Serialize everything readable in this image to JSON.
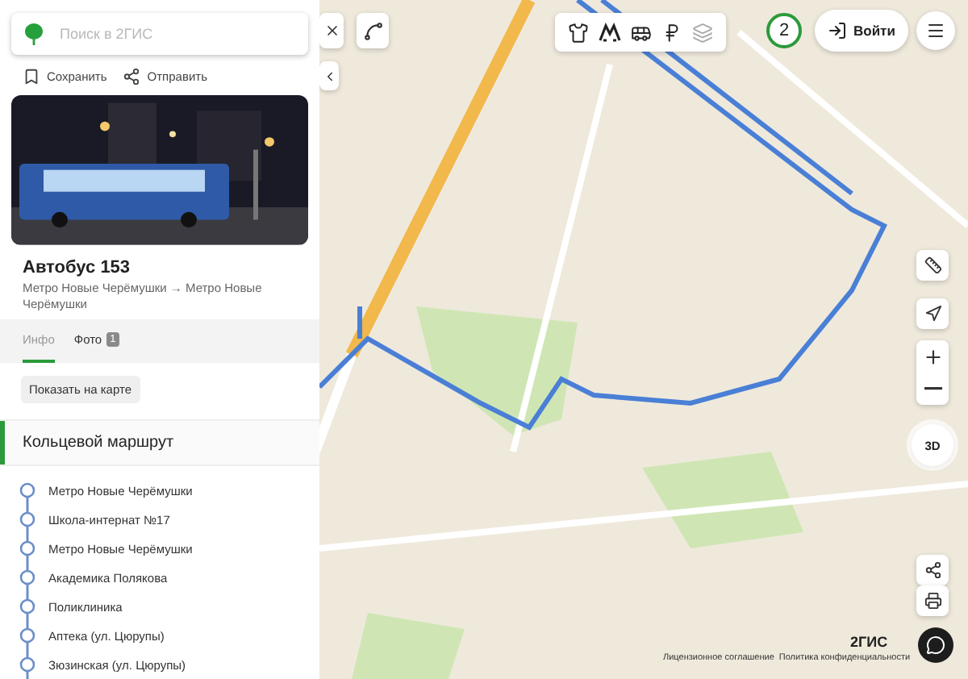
{
  "search": {
    "placeholder": "Поиск в 2ГИС"
  },
  "actions": [
    {
      "kind": "save",
      "label": "Сохранить"
    },
    {
      "kind": "share",
      "label": "Отправить"
    }
  ],
  "card": {
    "title": "Автобус 153",
    "subtitle": "Метро Новые Черёмушки → Метро Новые Черёмушки"
  },
  "tabs": [
    {
      "label": "Инфо",
      "selected": true
    },
    {
      "label": "Фото",
      "selected": false,
      "badge": "1"
    }
  ],
  "show_on_map_button": "Показать на карте",
  "route_section": {
    "title": "Кольцевой маршрут",
    "stops": [
      "Метро Новые Черёмушки",
      "Школа-интернат №17",
      "Метро Новые Черёмушки",
      "Академика Полякова",
      "Поликлиника",
      "Аптека (ул. Цюрупы)",
      "Зюзинская (ул. Цюрупы)"
    ]
  },
  "map_toolbar": {
    "layers": [
      {
        "kind": "shirt"
      },
      {
        "kind": "metro"
      },
      {
        "kind": "bus"
      },
      {
        "kind": "ruble"
      },
      {
        "kind": "layers"
      }
    ],
    "count": "2",
    "login": "Войти"
  },
  "map_controls": [
    {
      "kind": "ruler"
    },
    {
      "kind": "locate"
    },
    {
      "kind": "zoom-in"
    },
    {
      "kind": "zoom-out"
    },
    {
      "kind": "tilt",
      "label": "3D"
    },
    {
      "kind": "share"
    },
    {
      "kind": "print"
    }
  ],
  "footer": {
    "logo": "2ГИС",
    "links": [
      "Лицензионное соглашение",
      "Политика конфиденциальности"
    ]
  }
}
